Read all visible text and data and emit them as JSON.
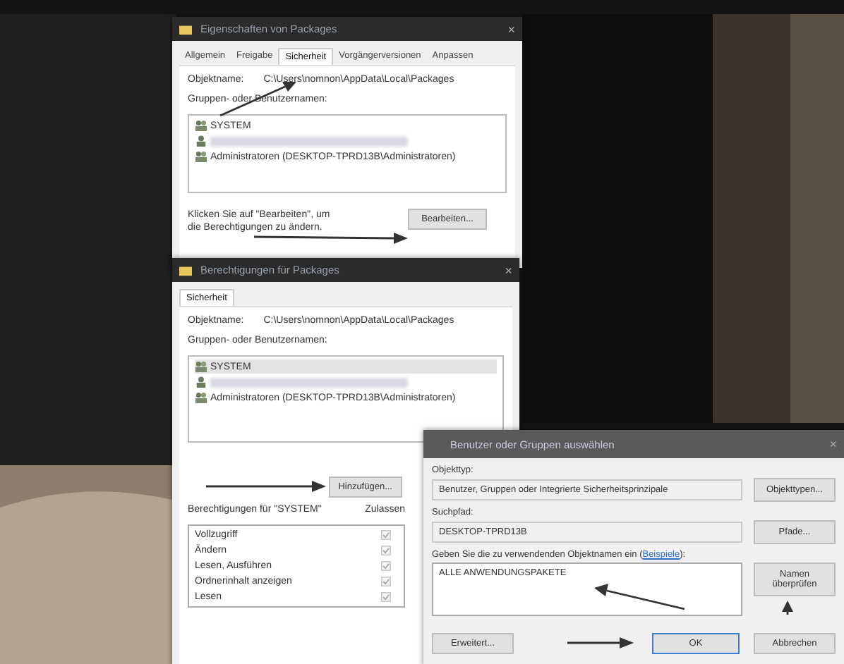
{
  "properties_window": {
    "title": "Eigenschaften von Packages",
    "close": "×",
    "tabs": [
      {
        "label": "Allgemein",
        "selected": false
      },
      {
        "label": "Freigabe",
        "selected": false
      },
      {
        "label": "Sicherheit",
        "selected": true
      },
      {
        "label": "Vorgängerversionen",
        "selected": false
      },
      {
        "label": "Anpassen",
        "selected": false
      }
    ],
    "object_label": "Objektname:",
    "object_path": "C:\\Users\\nomnon\\AppData\\Local\\Packages",
    "groups_label": "Gruppen- oder Benutzernamen:",
    "principals": [
      {
        "kind": "group",
        "name": "SYSTEM",
        "selected": false
      },
      {
        "kind": "redacted",
        "selected": false
      },
      {
        "kind": "group",
        "name": "Administratoren (DESKTOP-TPRD13B\\Administratoren)",
        "selected": false
      }
    ],
    "hint": "Klicken Sie auf \"Bearbeiten\", um die Berechtigungen zu ändern.",
    "edit_button": "Bearbeiten..."
  },
  "permissions_window": {
    "title": "Berechtigungen für Packages",
    "close": "×",
    "tab": "Sicherheit",
    "object_label": "Objektname:",
    "object_path": "C:\\Users\\nomnon\\AppData\\Local\\Packages",
    "groups_label": "Gruppen- oder Benutzernamen:",
    "principals": [
      {
        "kind": "group",
        "name": "SYSTEM",
        "selected": true
      },
      {
        "kind": "redacted",
        "selected": false
      },
      {
        "kind": "group",
        "name": "Administratoren (DESKTOP-TPRD13B\\Administratoren)",
        "selected": false
      }
    ],
    "add_button": "Hinzufügen...",
    "permissions_label": "Berechtigungen für \"SYSTEM\"",
    "allow_header": "Zulassen",
    "permissions": [
      {
        "name": "Vollzugriff",
        "allow": true
      },
      {
        "name": "Ändern",
        "allow": true
      },
      {
        "name": "Lesen, Ausführen",
        "allow": true
      },
      {
        "name": "Ordnerinhalt anzeigen",
        "allow": true
      },
      {
        "name": "Lesen",
        "allow": true
      }
    ]
  },
  "select_dialog": {
    "title": "Benutzer oder Gruppen auswählen",
    "close": "×",
    "object_type_label": "Objekttyp:",
    "object_type": "Benutzer, Gruppen oder Integrierte Sicherheitsprinzipale",
    "object_types_button": "Objekttypen...",
    "location_label": "Suchpfad:",
    "location": "DESKTOP-TPRD13B",
    "locations_button": "Pfade...",
    "names_label": {
      "before": "Geben Sie die zu verwendenden Objektnamen ein (",
      "link": "Beispiele",
      "after": "):"
    },
    "names_value": "ALLE ANWENDUNGSPAKETE",
    "check_names_button": "Namen überprüfen",
    "advanced_button": "Erweitert...",
    "ok_button": "OK",
    "cancel_button": "Abbrechen"
  }
}
